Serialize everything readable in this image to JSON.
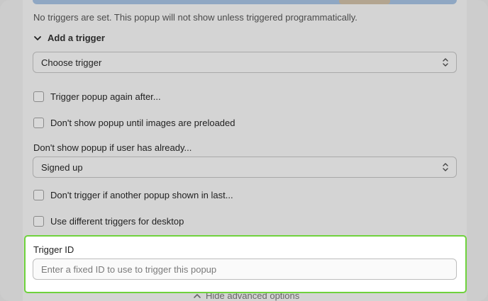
{
  "notice": "No triggers are set. This popup will not show unless triggered programmatically.",
  "add_trigger": {
    "heading": "Add a trigger",
    "select_value": "Choose trigger"
  },
  "options": {
    "trigger_again": "Trigger popup again after...",
    "preload_images": "Don't show popup until images are preloaded",
    "user_already_label": "Don't show popup if user has already...",
    "user_already_value": "Signed up",
    "another_popup": "Don't trigger if another popup shown in last...",
    "different_desktop": "Use different triggers for desktop"
  },
  "trigger_id": {
    "label": "Trigger ID",
    "placeholder": "Enter a fixed ID to use to trigger this popup",
    "value": ""
  },
  "hide_advanced": "Hide advanced options",
  "colors": {
    "highlight_border": "#6fd23d",
    "overlay": "#cdcdcd"
  },
  "icons": {
    "section_toggle": "chevron-down-icon",
    "select_toggle": "chevron-updown-icon",
    "hide_toggle": "chevron-up-icon"
  }
}
